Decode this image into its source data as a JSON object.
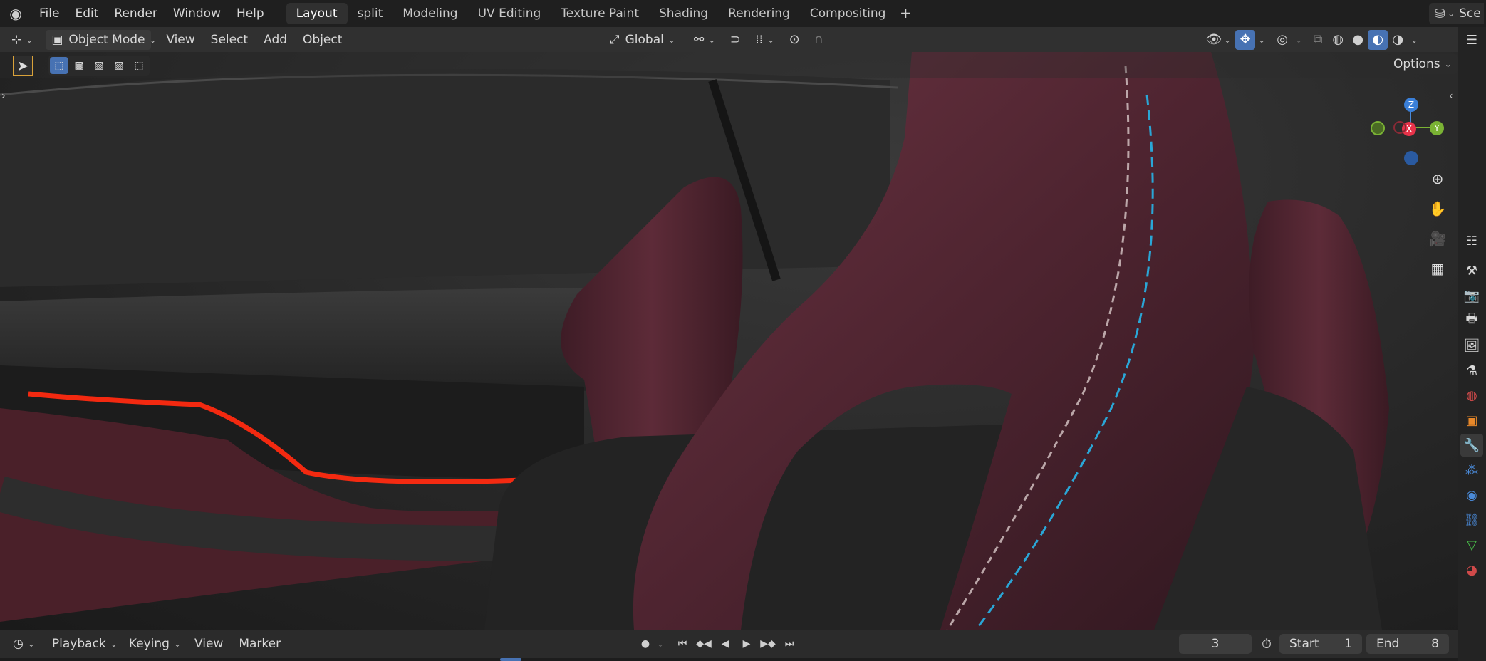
{
  "menus": [
    "File",
    "Edit",
    "Render",
    "Window",
    "Help"
  ],
  "workspaces": [
    "Layout",
    "split",
    "Modeling",
    "UV Editing",
    "Texture Paint",
    "Shading",
    "Rendering",
    "Compositing"
  ],
  "active_workspace": "Layout",
  "scene_label": "Sce",
  "header": {
    "mode": "Object Mode",
    "menus": [
      "View",
      "Select",
      "Add",
      "Object"
    ],
    "orientation": "Global"
  },
  "options_label": "Options",
  "gizmo": {
    "z": "Z",
    "x": "X",
    "y": "Y"
  },
  "timeline": {
    "menus": [
      "Playback",
      "Keying",
      "View",
      "Marker"
    ],
    "current_frame": "3",
    "start_label": "Start",
    "start": "1",
    "end_label": "End",
    "end": "8"
  },
  "colors": {
    "accent": "#4772b3",
    "seat": "#5a2a36",
    "stitch_blue": "#2aa6d6",
    "led_red": "#ff2a10"
  }
}
